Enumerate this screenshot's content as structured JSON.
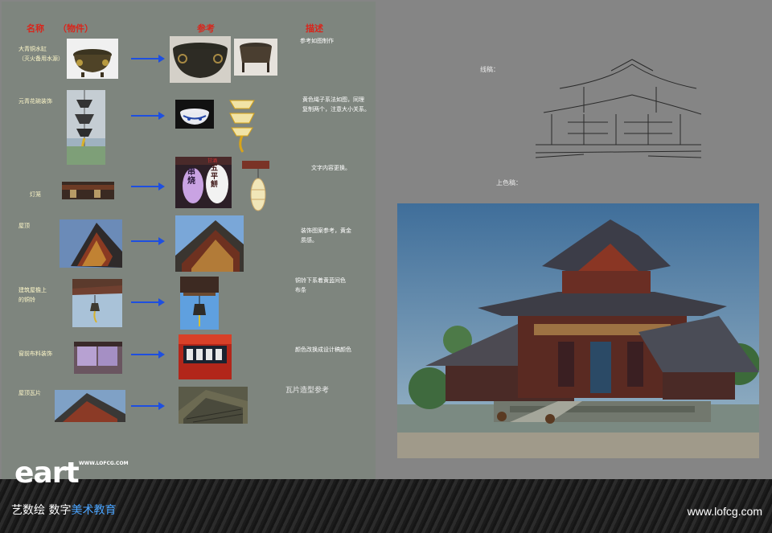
{
  "header": {
    "name": "名称",
    "object": "（物件）",
    "reference": "参考",
    "description": "描述"
  },
  "rows": [
    {
      "name": "大青铜水缸\n（灭火备用水源）",
      "desc": "参考如图制作"
    },
    {
      "name": "元青花碗装饰",
      "desc": "黄色绳子系法如图，同理\n复制两个，注意大小关系。"
    },
    {
      "name": "灯笼",
      "desc": "文字内容更换。"
    },
    {
      "name": "屋顶",
      "desc": "装饰图案参考，黄金\n质感。"
    },
    {
      "name": "建筑屋檐上\n的铜铃",
      "desc": "铜铃下系着黄蓝间色\n布条"
    },
    {
      "name": "窗前布料装饰",
      "desc": "颜色改换成设计稿颜色"
    },
    {
      "name": "屋顶瓦片",
      "desc": "瓦片造型参考"
    }
  ],
  "lantern_text": {
    "left": "串烧",
    "right": "五平餅",
    "top": "甘酒"
  },
  "right_notes": {
    "line_draft": "线稿：",
    "color_draft": "上色稿："
  },
  "footer": {
    "logo": "eart",
    "logo_small": "WWW.LOFCG.COM",
    "tagline_a": "艺数绘 数字",
    "tagline_b": "美术教育",
    "url": "www.lofcg.com"
  }
}
